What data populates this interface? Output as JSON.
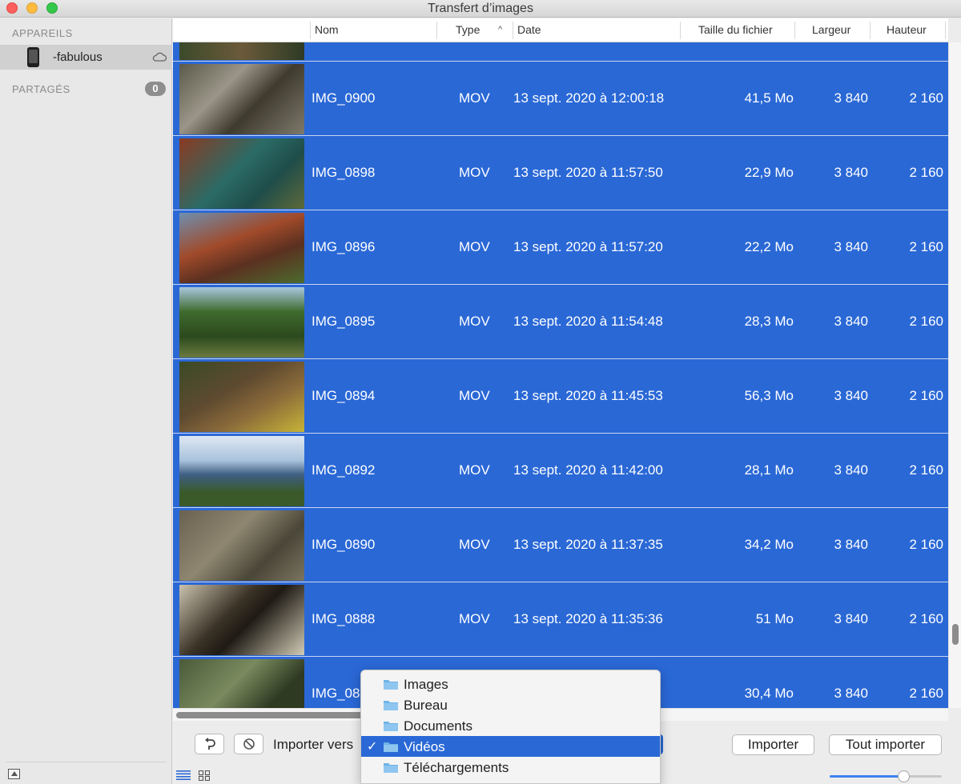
{
  "window": {
    "title": "Transfert d’images"
  },
  "sidebar": {
    "devices_header": "APPAREILS",
    "device_name": "-fabulous",
    "shared_header": "PARTAGÉS",
    "shared_count": "0"
  },
  "table": {
    "columns": {
      "name": "Nom",
      "type": "Type",
      "date": "Date",
      "size": "Taille du fichier",
      "width": "Largeur",
      "height": "Hauteur"
    },
    "rows": [
      {
        "name": "IMG_0900",
        "type": "MOV",
        "date": "13 sept. 2020 à 12:00:18",
        "size": "41,5 Mo",
        "width": "3 840",
        "height": "2 160"
      },
      {
        "name": "IMG_0898",
        "type": "MOV",
        "date": "13 sept. 2020 à 11:57:50",
        "size": "22,9 Mo",
        "width": "3 840",
        "height": "2 160"
      },
      {
        "name": "IMG_0896",
        "type": "MOV",
        "date": "13 sept. 2020 à 11:57:20",
        "size": "22,2 Mo",
        "width": "3 840",
        "height": "2 160"
      },
      {
        "name": "IMG_0895",
        "type": "MOV",
        "date": "13 sept. 2020 à 11:54:48",
        "size": "28,3 Mo",
        "width": "3 840",
        "height": "2 160"
      },
      {
        "name": "IMG_0894",
        "type": "MOV",
        "date": "13 sept. 2020 à 11:45:53",
        "size": "56,3 Mo",
        "width": "3 840",
        "height": "2 160"
      },
      {
        "name": "IMG_0892",
        "type": "MOV",
        "date": "13 sept. 2020 à 11:42:00",
        "size": "28,1 Mo",
        "width": "3 840",
        "height": "2 160"
      },
      {
        "name": "IMG_0890",
        "type": "MOV",
        "date": "13 sept. 2020 à 11:37:35",
        "size": "34,2 Mo",
        "width": "3 840",
        "height": "2 160"
      },
      {
        "name": "IMG_0888",
        "type": "MOV",
        "date": "13 sept. 2020 à 11:35:36",
        "size": "51 Mo",
        "width": "3 840",
        "height": "2 160"
      },
      {
        "name": "IMG_08",
        "type": "",
        "date": "6",
        "size": "30,4 Mo",
        "width": "3 840",
        "height": "2 160"
      }
    ]
  },
  "bottombar": {
    "import_to_label": "Importer vers",
    "import_button": "Importer",
    "import_all_button": "Tout importer",
    "rotate_icon": "rotate-left-icon",
    "delete_icon": "no-entry-icon"
  },
  "menu": {
    "items": [
      {
        "label": "Images",
        "icon": "folder-icon"
      },
      {
        "label": "Bureau",
        "icon": "folder-icon"
      },
      {
        "label": "Documents",
        "icon": "folder-icon"
      },
      {
        "label": "Vidéos",
        "icon": "folder-icon",
        "checked": true
      },
      {
        "label": "Téléchargements",
        "icon": "folder-icon"
      }
    ],
    "checkmark": "✓"
  },
  "colors": {
    "selection": "#2a68d6",
    "accent": "#3b82f0"
  }
}
